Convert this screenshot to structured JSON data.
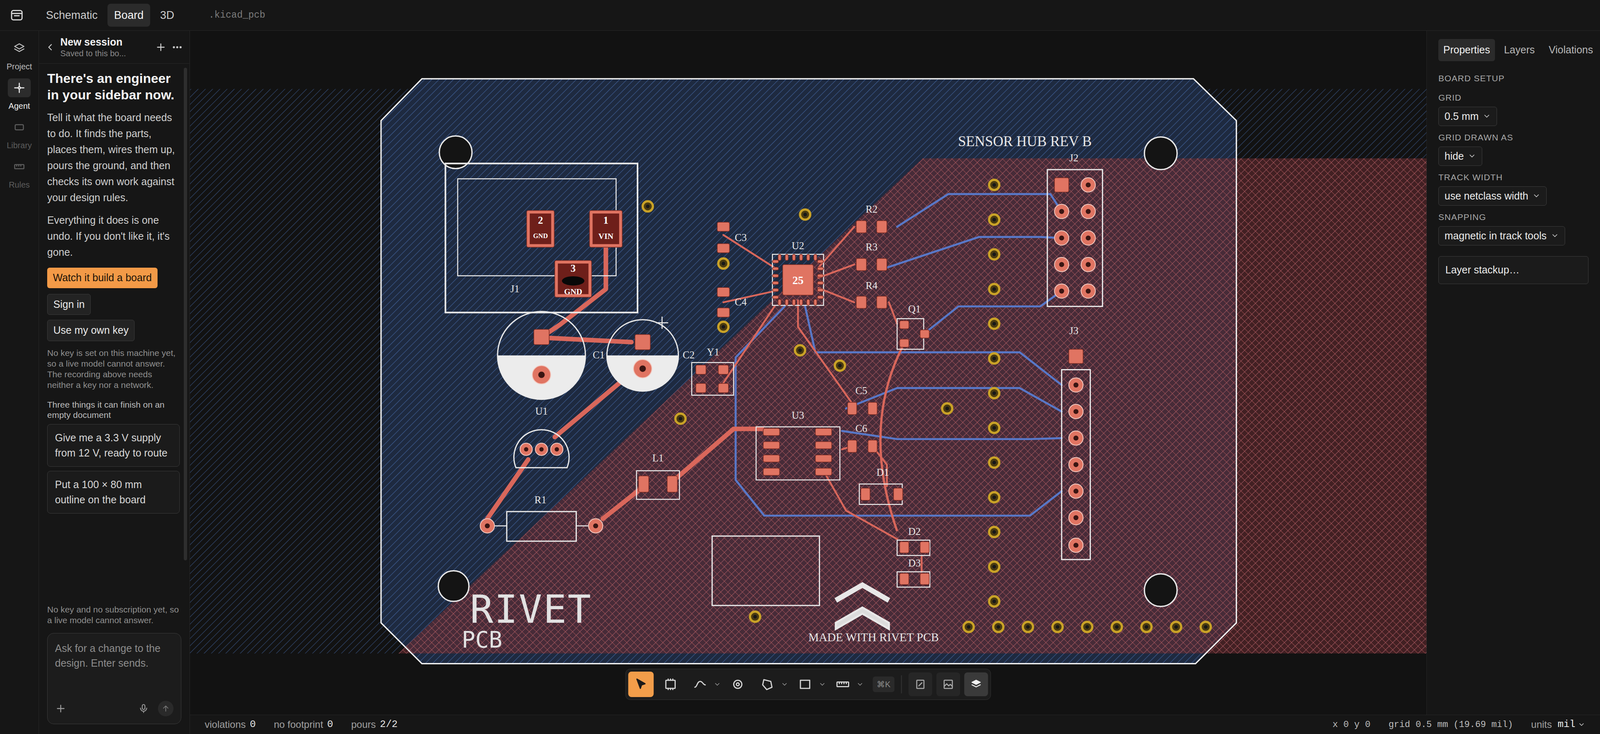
{
  "topbar": {
    "tabs": [
      {
        "label": "Schematic",
        "selected": false
      },
      {
        "label": "Board",
        "selected": true
      },
      {
        "label": "3D",
        "selected": false
      }
    ],
    "file": ".kicad_pcb"
  },
  "rail": {
    "items": [
      {
        "label": "Project",
        "selected": false,
        "disabled": false
      },
      {
        "label": "Agent",
        "selected": true,
        "disabled": false
      },
      {
        "label": "Library",
        "selected": false,
        "disabled": true
      },
      {
        "label": "Rules",
        "selected": false,
        "disabled": true
      }
    ]
  },
  "session": {
    "title": "New session",
    "subtitle": "Saved to this bo..."
  },
  "agent": {
    "heading": "There's an engineer in your sidebar now.",
    "paragraphs": [
      "Tell it what the board needs to do. It finds the parts, places them, wires them up, pours the ground, and then checks its own work against your design rules.",
      "Everything it does is one undo. If you don't like it, it's gone."
    ],
    "buttons": [
      {
        "label": "Watch it build a board",
        "kind": "primary"
      },
      {
        "label": "Sign in",
        "kind": "secondary"
      },
      {
        "label": "Use my own key",
        "kind": "secondary"
      }
    ],
    "note": "No key is set on this machine yet, so a live model cannot answer. The recording above needs neither a key nor a network.",
    "suggestions_title": "Three things it can finish on an empty document",
    "suggestions": [
      "Give me a 3.3 V supply from 12 V, ready to route",
      "Put a 100 × 80 mm outline on the board"
    ],
    "notice": "No key and no subscription yet, so a live model cannot answer.",
    "input": {
      "placeholder": "Ask for a change to the design. Enter sends."
    }
  },
  "canvas": {
    "title": "SENSOR HUB REV B",
    "refs": [
      "J1",
      "C1",
      "U1",
      "R1",
      "L1",
      "C2",
      "Y1",
      "C3",
      "C4",
      "U2",
      "R2",
      "R3",
      "R4",
      "Q1",
      "U3",
      "C5",
      "C6",
      "D1",
      "D2",
      "D3",
      "J2",
      "J3"
    ],
    "pads": [
      {
        "number": "2",
        "net": "GND"
      },
      {
        "number": "1",
        "net": "VIN"
      },
      {
        "number": "3",
        "net": "GND"
      }
    ],
    "chip_pin": "25",
    "logo": "RIVET",
    "logo_sub": "PCB",
    "credit": "MADE WITH RIVET PCB"
  },
  "toolbar": {
    "tools": [
      {
        "kind": "select",
        "selected": true,
        "menu": false
      },
      {
        "kind": "footprint",
        "selected": false,
        "menu": false
      },
      {
        "kind": "route",
        "selected": false,
        "menu": true
      },
      {
        "kind": "via",
        "selected": false,
        "menu": false
      },
      {
        "kind": "zone",
        "selected": false,
        "menu": true
      },
      {
        "kind": "rect",
        "selected": false,
        "menu": true
      },
      {
        "kind": "measure",
        "selected": false,
        "menu": true
      }
    ],
    "shortcut": "⌘K",
    "toggles": [
      {
        "kind": "ratsnest",
        "on": false
      },
      {
        "kind": "pour",
        "on": false
      },
      {
        "kind": "layers",
        "on": true
      }
    ]
  },
  "inspector": {
    "tabs": [
      {
        "label": "Properties",
        "selected": true
      },
      {
        "label": "Layers",
        "selected": false
      },
      {
        "label": "Violations",
        "selected": false
      }
    ],
    "section": "BOARD SETUP",
    "fields": [
      {
        "label": "GRID",
        "value": "0.5 mm"
      },
      {
        "label": "GRID DRAWN AS",
        "value": "hide"
      },
      {
        "label": "TRACK WIDTH",
        "value": "use netclass width"
      },
      {
        "label": "SNAPPING",
        "value": "magnetic in track tools"
      }
    ],
    "button": "Layer stackup…"
  },
  "status_bar": {
    "counters": [
      {
        "label": "violations",
        "value": "0"
      },
      {
        "label": "no footprint",
        "value": "0"
      },
      {
        "label": "pours",
        "value": "2/2"
      }
    ],
    "coords": "x 0 y 0",
    "grid": "grid 0.5 mm (19.69 mil)",
    "units_label": "units",
    "units": "mil"
  }
}
